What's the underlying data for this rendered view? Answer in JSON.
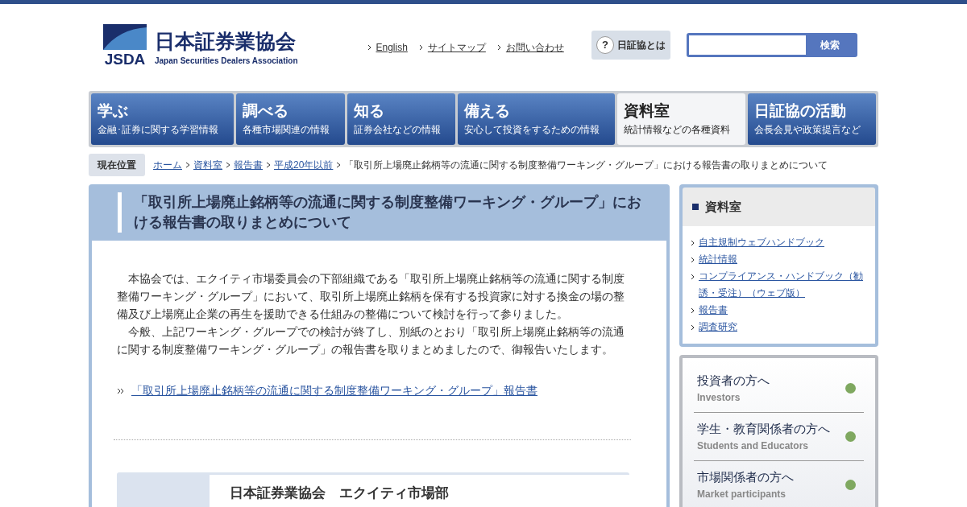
{
  "header": {
    "logo_abbr": "JSDA",
    "logo_name": "日本証券業協会",
    "logo_subtitle": "Japan Securities Dealers Association",
    "links": [
      "English",
      "サイトマップ",
      "お問い合わせ"
    ],
    "about_button": "日証協とは",
    "about_icon": "?",
    "search": {
      "button": "検索"
    }
  },
  "nav": [
    {
      "title": "学ぶ",
      "subtitle": "金融･証券に関する学習情報",
      "selected": false
    },
    {
      "title": "調べる",
      "subtitle": "各種市場関連の情報",
      "selected": false
    },
    {
      "title": "知る",
      "subtitle": "証券会社などの情報",
      "selected": false
    },
    {
      "title": "備える",
      "subtitle": "安心して投資をするための情報",
      "selected": false
    },
    {
      "title": "資料室",
      "subtitle": "統計情報などの各種資料",
      "selected": true
    },
    {
      "title": "日証協の活動",
      "subtitle": "会長会見や政策提言など",
      "selected": false
    }
  ],
  "breadcrumb": {
    "label": "現在位置",
    "links": [
      "ホーム",
      "資料室",
      "報告書",
      "平成20年以前"
    ],
    "current": "「取引所上場廃止銘柄等の流通に関する制度整備ワーキング・グループ」における報告書の取りまとめについて"
  },
  "article": {
    "title": "「取引所上場廃止銘柄等の流通に関する制度整備ワーキング・グループ」における報告書の取りまとめについて",
    "paragraphs": [
      "本協会では、エクイティ市場委員会の下部組織である「取引所上場廃止銘柄等の流通に関する制度整備ワーキング・グループ」において、取引所上場廃止銘柄を保有する投資家に対する換金の場の整備及び上場廃止企業の再生を援助できる仕組みの整備について検討を行って参りました。",
      "今般、上記ワーキング・グループでの検討が終了し、別紙のとおり「取引所上場廃止銘柄等の流通に関する制度整備ワーキング・グループ」の報告書を取りまとめましたので、御報告いたします。"
    ],
    "document_link": "「取引所上場廃止銘柄等の流通に関する制度整備ワーキング・グループ」報告書",
    "contact_title": "日本証券業協会　エクイティ市場部"
  },
  "sidebar": {
    "title": "資料室",
    "links": [
      "自主規制ウェブハンドブック",
      "統計情報",
      "コンプライアンス・ハンドブック（勧誘・受注）（ウェブ版）",
      "報告書",
      "調査研究"
    ],
    "audiences": [
      {
        "title": "投資者の方へ",
        "subtitle": "Investors"
      },
      {
        "title": "学生・教育関係者の方へ",
        "subtitle": "Students and Educators"
      },
      {
        "title": "市場関係者の方へ",
        "subtitle": "Market participants"
      }
    ]
  }
}
